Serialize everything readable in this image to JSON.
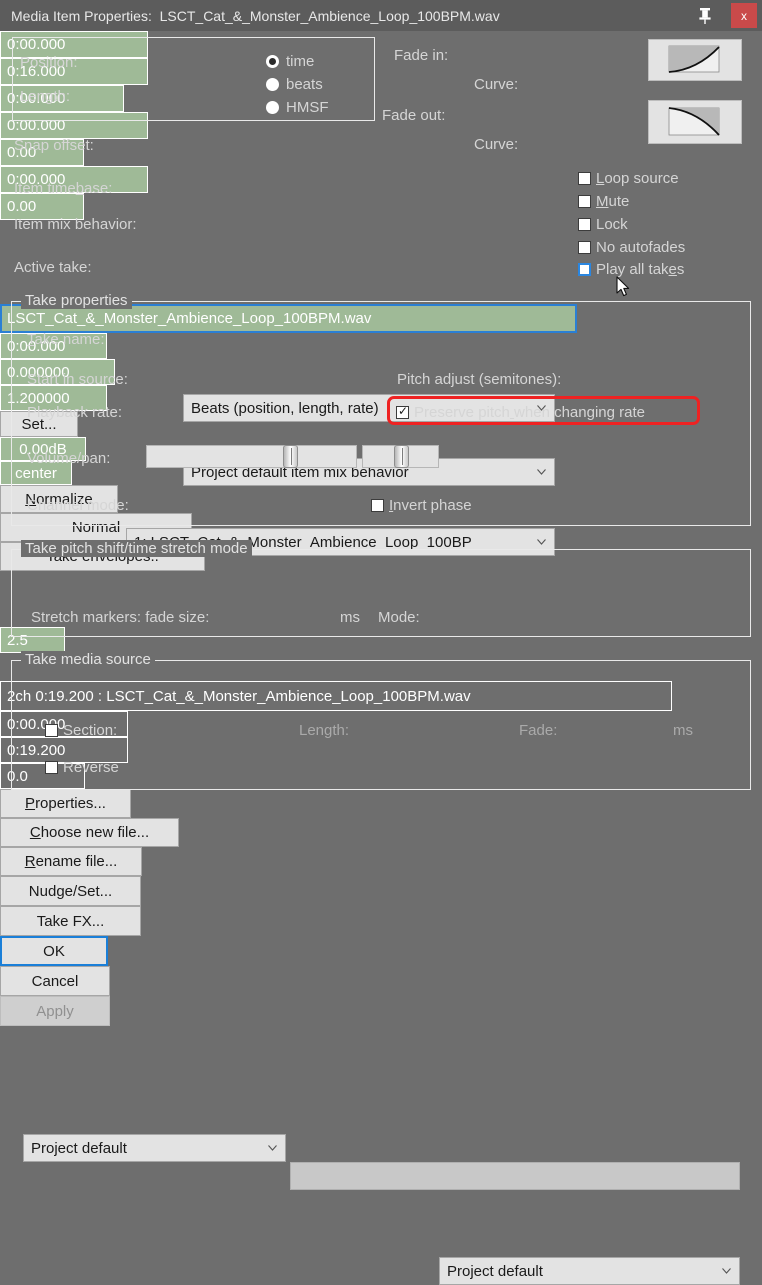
{
  "window": {
    "title_prefix": "Media Item Properties:",
    "title_file": "LSCT_Cat_&_Monster_Ambience_Loop_100BPM.wav",
    "pin_icon": "pushpin-icon",
    "close_label": "x",
    "close_color": "#c94a4a",
    "bg_color": "#6e6e6e",
    "field_color": "#9fba97"
  },
  "position_group": {
    "position_label": "Position:",
    "position_value": "0:00.000",
    "length_label": "Length:",
    "length_value": "0:16.000",
    "timebase_options": [
      {
        "label": "time",
        "selected": true
      },
      {
        "label": "beats",
        "selected": false
      },
      {
        "label": "HMSF",
        "selected": false
      }
    ]
  },
  "snap": {
    "label": "Snap offset:",
    "value": "0:00.000"
  },
  "fade": {
    "fade_in_label": "Fade in:",
    "fade_in_value": "0:00.000",
    "fade_in_curve_label": "Curve:",
    "fade_in_curve_value": "0.00",
    "fade_out_label": "Fade out:",
    "fade_out_value": "0:00.000",
    "fade_out_curve_label": "Curve:",
    "fade_out_curve_value": "0.00",
    "fade_in_shape_icon": "fade-in-curve-icon",
    "fade_out_shape_icon": "fade-out-curve-icon"
  },
  "item_options": {
    "timebase_label": "Item timebase:",
    "timebase_value": "Beats (position, length, rate)",
    "mix_behavior_label": "Item mix behavior:",
    "mix_behavior_value": "Project default item mix behavior",
    "active_take_label": "Active take:",
    "active_take_value": "1: LSCT_Cat_&_Monster_Ambience_Loop_100BP"
  },
  "item_checkboxes": [
    {
      "label": "Loop source",
      "checked": false,
      "focused": false
    },
    {
      "label": "Mute",
      "checked": false,
      "focused": false
    },
    {
      "label": "Lock",
      "checked": false,
      "focused": false
    },
    {
      "label": "No autofades",
      "checked": false,
      "focused": false
    },
    {
      "label": "Play all takes",
      "checked": false,
      "focused": true
    }
  ],
  "take_properties": {
    "group_label": "Take properties",
    "take_name_label": "Take name:",
    "take_name_value": "LSCT_Cat_&_Monster_Ambience_Loop_100BPM.wav",
    "start_in_source_label": "Start in source:",
    "start_in_source_value": "0:00.000",
    "pitch_adjust_label": "Pitch adjust (semitones):",
    "pitch_adjust_value": "0.000000",
    "playback_rate_label": "Playback rate:",
    "playback_rate_value": "1.200000",
    "set_button": "Set...",
    "preserve_pitch_label": "Preserve pitch when changing rate",
    "preserve_pitch_checked": true,
    "preserve_pitch_highlight_color": "#ee2222",
    "volume_pan_label": "Volume/pan:",
    "volume_value": "0.00dB",
    "pan_value": "center",
    "normalize_button": "Normalize",
    "channel_mode_label": "Channel mode:",
    "channel_mode_value": "Normal",
    "invert_phase_label": "Invert phase",
    "invert_phase_checked": false,
    "take_envelopes_button": "Take envelopes.."
  },
  "pitch_shift": {
    "group_label": "Take pitch shift/time stretch mode",
    "mode_value": "Project default",
    "secondary_value": "",
    "stretch_markers_label": "Stretch markers: fade size:",
    "fade_size_value": "2.5",
    "ms_label": "ms",
    "mode_label": "Mode:",
    "stretch_mode_value": "Project default"
  },
  "media_source": {
    "group_label": "Take media source",
    "source_info": "2ch 0:19.200 : LSCT_Cat_&_Monster_Ambience_Loop_100BPM.wav",
    "section_label": "Section:",
    "section_checked": false,
    "section_start": "0:00.000",
    "length_label": "Length:",
    "length_value": "0:19.200",
    "fade_label": "Fade:",
    "fade_value": "0.0",
    "ms_label": "ms",
    "reverse_label": "Reverse",
    "reverse_checked": false,
    "properties_button": "Properties...",
    "choose_new_file_button": "Choose new file...",
    "rename_file_button": "Rename file..."
  },
  "footer": {
    "nudge_button": "Nudge/Set...",
    "take_fx_button": "Take FX...",
    "ok_button": "OK",
    "cancel_button": "Cancel",
    "apply_button": "Apply",
    "apply_disabled": true
  }
}
